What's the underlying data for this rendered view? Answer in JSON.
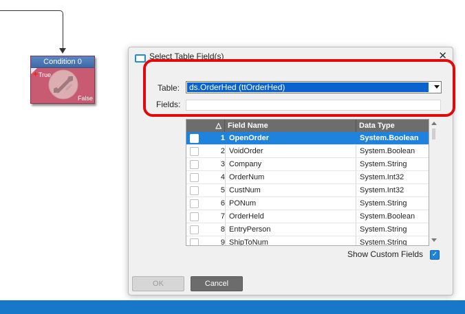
{
  "canvas": {
    "condition_node": {
      "title": "Condition 0",
      "true_label": "True",
      "false_label": "False",
      "icon": "swap-arrows-icon"
    }
  },
  "dialog": {
    "title": "Select Table Field(s)",
    "close_glyph": "✕",
    "table_label": "Table:",
    "table_value": "ds.OrderHed (ttOrderHed)",
    "fields_label": "Fields:",
    "fields_value": "",
    "grid": {
      "headers": {
        "sort_glyph": "△",
        "field_name": "Field Name",
        "data_type": "Data Type"
      },
      "rows": [
        {
          "num": "1",
          "name": "OpenOrder",
          "type": "System.Boolean",
          "selected": true
        },
        {
          "num": "2",
          "name": "VoidOrder",
          "type": "System.Boolean",
          "selected": false
        },
        {
          "num": "3",
          "name": "Company",
          "type": "System.String",
          "selected": false
        },
        {
          "num": "4",
          "name": "OrderNum",
          "type": "System.Int32",
          "selected": false
        },
        {
          "num": "5",
          "name": "CustNum",
          "type": "System.Int32",
          "selected": false
        },
        {
          "num": "6",
          "name": "PONum",
          "type": "System.String",
          "selected": false
        },
        {
          "num": "7",
          "name": "OrderHeld",
          "type": "System.Boolean",
          "selected": false
        },
        {
          "num": "8",
          "name": "EntryPerson",
          "type": "System.String",
          "selected": false
        },
        {
          "num": "9",
          "name": "ShipToNum",
          "type": "System.String",
          "selected": false
        }
      ]
    },
    "show_custom_fields_label": "Show Custom Fields",
    "show_custom_fields_checked": true,
    "ok_label": "OK",
    "cancel_label": "Cancel"
  },
  "colors": {
    "accent": "#1f82dc",
    "highlight_box": "#e00a0a",
    "node": "#c85b72"
  }
}
